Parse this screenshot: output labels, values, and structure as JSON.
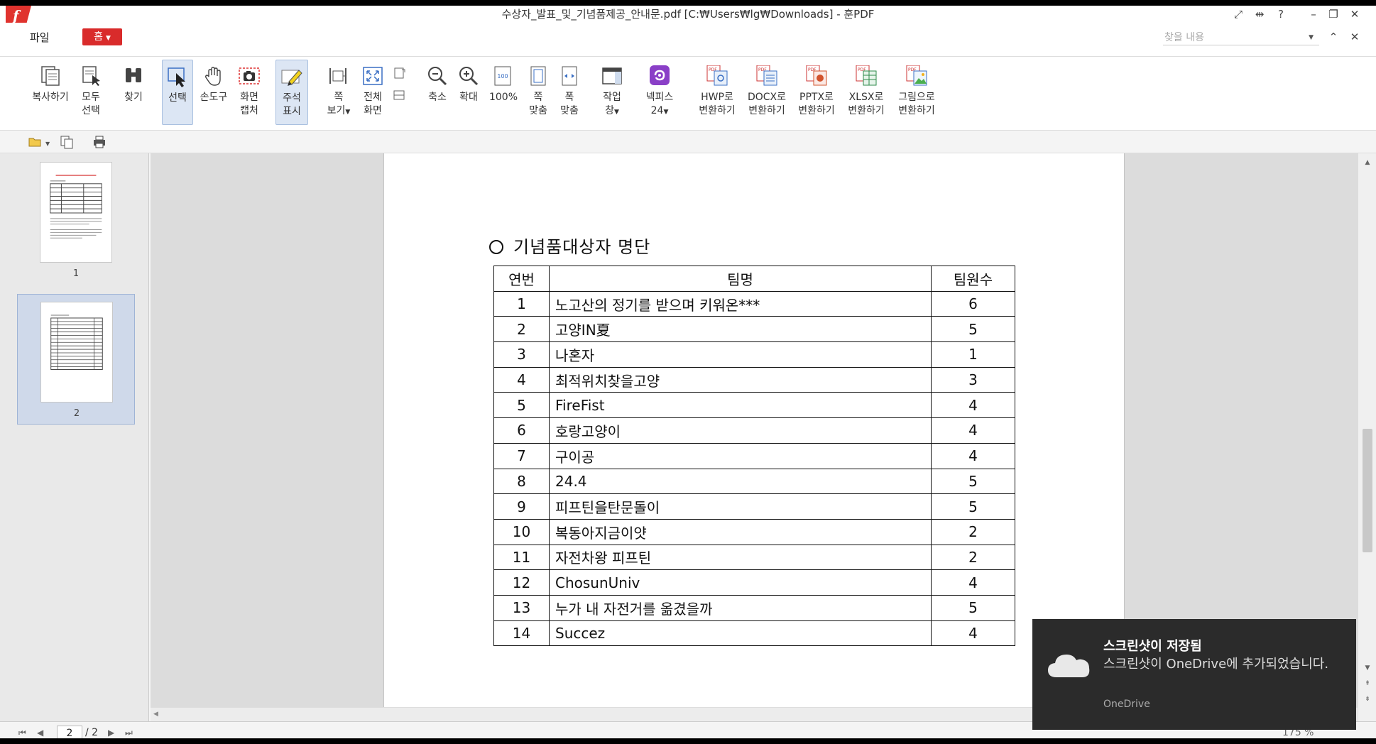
{
  "window": {
    "title": "수상자_발표_및_기념품제공_안내문.pdf [C:₩Users₩lg₩Downloads] - 훈PDF",
    "logo_letter": "f"
  },
  "menu": {
    "file": "파일",
    "home": "홈",
    "find_placeholder": "찾을 내용"
  },
  "ribbon": {
    "copy": "복사하기",
    "select_all": [
      "모두",
      "선택"
    ],
    "find": "찾기",
    "select": "선택",
    "hand": "손도구",
    "capture": [
      "화면",
      "캡처"
    ],
    "annotation": [
      "주석",
      "표시"
    ],
    "page_view": [
      "쪽",
      "보기"
    ],
    "fullscreen": [
      "전체",
      "화면"
    ],
    "zoom_out": "축소",
    "zoom_in": "확대",
    "zoom_100": "100%",
    "fit_page": [
      "쪽",
      "맞춤"
    ],
    "fit_width": [
      "폭",
      "맞춤"
    ],
    "window": [
      "작업",
      "창"
    ],
    "nexpis": [
      "넥피스",
      "24"
    ],
    "to_hwp": [
      "HWP로",
      "변환하기"
    ],
    "to_docx": [
      "DOCX로",
      "변환하기"
    ],
    "to_pptx": [
      "PPTX로",
      "변환하기"
    ],
    "to_xlsx": [
      "XLSX로",
      "변환하기"
    ],
    "to_image": [
      "그림으로",
      "변환하기"
    ]
  },
  "thumbnails": [
    {
      "num": "1"
    },
    {
      "num": "2"
    }
  ],
  "document": {
    "section_title": "기념품대상자 명단",
    "headers": [
      "연번",
      "팀명",
      "팀원수"
    ],
    "rows": [
      [
        "1",
        "노고산의 정기를  받으며 키워온***",
        "6"
      ],
      [
        "2",
        "고양IN夏",
        "5"
      ],
      [
        "3",
        "나혼자",
        "1"
      ],
      [
        "4",
        "최적위치찾을고양",
        "3"
      ],
      [
        "5",
        "FireFist",
        "4"
      ],
      [
        "6",
        "호랑고양이",
        "4"
      ],
      [
        "7",
        "구이공",
        "4"
      ],
      [
        "8",
        "24.4",
        "5"
      ],
      [
        "9",
        "피프틴을탄문돌이",
        "5"
      ],
      [
        "10",
        "복동아지금이얏",
        "2"
      ],
      [
        "11",
        "자전차왕 피프틴",
        "2"
      ],
      [
        "12",
        "ChosunUniv",
        "4"
      ],
      [
        "13",
        "누가 내 자전거를 옮겼을까",
        "5"
      ],
      [
        "14",
        "Succez",
        "4"
      ]
    ]
  },
  "status": {
    "current_page": "2",
    "total_pages": "/ 2",
    "zoom": "175 %"
  },
  "toast": {
    "title": "스크린샷이 저장됨",
    "body": "스크린샷이 OneDrive에 추가되었습니다.",
    "source": "OneDrive"
  },
  "colors": {
    "brand_red": "#d92b2b",
    "selected_blue": "#dce6f4",
    "toast_bg": "#2b2b2b"
  }
}
